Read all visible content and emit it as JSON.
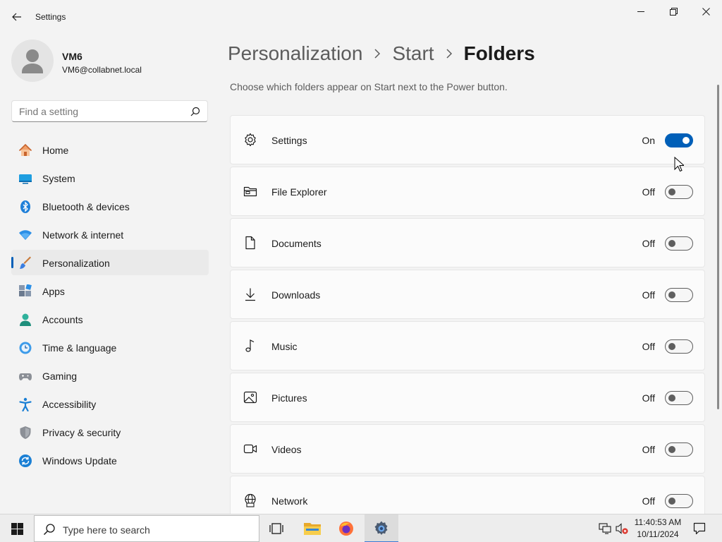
{
  "window": {
    "title": "Settings",
    "controls": [
      "minimize",
      "maximize",
      "close"
    ]
  },
  "profile": {
    "name": "VM6",
    "email": "VM6@collabnet.local"
  },
  "search": {
    "placeholder": "Find a setting"
  },
  "sidebar": {
    "selected": "Personalization",
    "items": [
      {
        "label": "Home",
        "icon": "home-icon"
      },
      {
        "label": "System",
        "icon": "system-icon"
      },
      {
        "label": "Bluetooth & devices",
        "icon": "bluetooth-icon"
      },
      {
        "label": "Network & internet",
        "icon": "wifi-icon"
      },
      {
        "label": "Personalization",
        "icon": "brush-icon"
      },
      {
        "label": "Apps",
        "icon": "apps-icon"
      },
      {
        "label": "Accounts",
        "icon": "accounts-icon"
      },
      {
        "label": "Time & language",
        "icon": "clock-globe-icon"
      },
      {
        "label": "Gaming",
        "icon": "gamepad-icon"
      },
      {
        "label": "Accessibility",
        "icon": "accessibility-icon"
      },
      {
        "label": "Privacy & security",
        "icon": "shield-icon"
      },
      {
        "label": "Windows Update",
        "icon": "update-icon"
      }
    ]
  },
  "breadcrumb": {
    "items": [
      "Personalization",
      "Start"
    ],
    "current": "Folders"
  },
  "description": "Choose which folders appear on Start next to the Power button.",
  "folders": [
    {
      "label": "Settings",
      "state": "On",
      "on": true,
      "icon": "gear-icon"
    },
    {
      "label": "File Explorer",
      "state": "Off",
      "on": false,
      "icon": "folder-icon"
    },
    {
      "label": "Documents",
      "state": "Off",
      "on": false,
      "icon": "document-icon"
    },
    {
      "label": "Downloads",
      "state": "Off",
      "on": false,
      "icon": "download-icon"
    },
    {
      "label": "Music",
      "state": "Off",
      "on": false,
      "icon": "music-note-icon"
    },
    {
      "label": "Pictures",
      "state": "Off",
      "on": false,
      "icon": "picture-icon"
    },
    {
      "label": "Videos",
      "state": "Off",
      "on": false,
      "icon": "video-icon"
    },
    {
      "label": "Network",
      "state": "Off",
      "on": false,
      "icon": "network-globe-icon"
    }
  ],
  "taskbar": {
    "search_placeholder": "Type here to search",
    "apps": [
      "task-view",
      "file-explorer",
      "firefox",
      "settings"
    ],
    "clock_time": "11:40:53 AM",
    "clock_date": "10/11/2024"
  },
  "colors": {
    "accent": "#005fb8",
    "background": "#f3f3f3",
    "card": "#fbfbfb"
  }
}
